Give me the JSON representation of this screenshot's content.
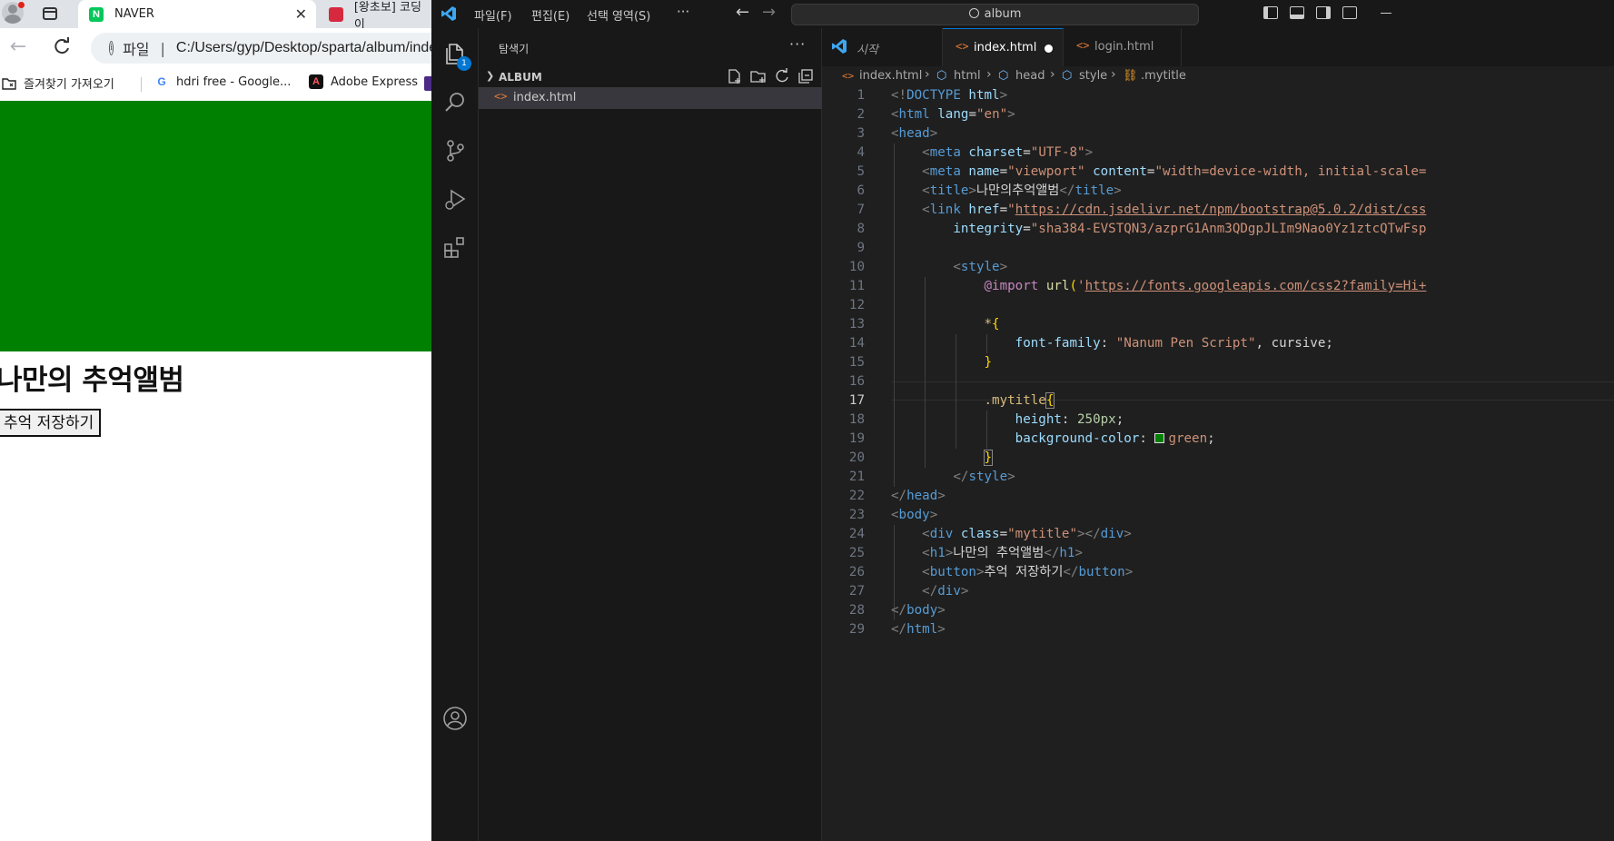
{
  "browser": {
    "tabs": [
      {
        "label": "NAVER",
        "icon": "naver-icon"
      },
      {
        "label": "[왕초보] 코딩이",
        "icon": "book-icon"
      }
    ],
    "address": {
      "scheme_label": "파일",
      "url": "C:/Users/gyp/Desktop/sparta/album/index.html"
    },
    "bookmarks": [
      {
        "label": "즐겨찾기 가져오기",
        "icon": "folder-import-icon"
      },
      {
        "label": "hdri free - Google...",
        "icon": "google-icon"
      },
      {
        "label": "Adobe Express",
        "icon": "adobe-express-icon"
      }
    ],
    "page": {
      "heading": "나만의 추억앨범",
      "button_label": "추억 저장하기",
      "banner_color": "#008000"
    }
  },
  "vscode": {
    "menu": [
      "파일(F)",
      "편집(E)",
      "선택 영역(S)",
      "···"
    ],
    "search_label": "album",
    "sidebar": {
      "title": "탐색기",
      "more": "···",
      "folder": "ALBUM",
      "files": [
        {
          "name": "index.html",
          "icon": "html-file-icon"
        }
      ]
    },
    "badge_count": "1",
    "tabs": [
      {
        "label": "시작",
        "icon": "vscode-icon"
      },
      {
        "label": "index.html",
        "icon": "html-file-icon",
        "modified": true
      },
      {
        "label": "login.html",
        "icon": "html-file-icon"
      }
    ],
    "breadcrumbs": [
      "index.html",
      "html",
      "head",
      "style",
      ".mytitle"
    ],
    "current_line": 17,
    "line_numbers": [
      "1",
      "2",
      "3",
      "4",
      "5",
      "6",
      "7",
      "8",
      "9",
      "10",
      "11",
      "12",
      "13",
      "14",
      "15",
      "16",
      "17",
      "18",
      "19",
      "20",
      "21",
      "22",
      "23",
      "24",
      "25",
      "26",
      "27",
      "28",
      "29"
    ],
    "code": {
      "l1": {
        "a": "<!",
        "b": "DOCTYPE",
        "c": " html",
        "d": ">"
      },
      "l2": {
        "a": "<",
        "b": "html",
        "c": " lang",
        "d": "=",
        "e": "\"en\"",
        "f": ">"
      },
      "l3": {
        "a": "<",
        "b": "head",
        "c": ">"
      },
      "l4": {
        "a": "<",
        "b": "meta",
        "c": " charset",
        "d": "=",
        "e": "\"UTF-8\"",
        "f": ">"
      },
      "l5": {
        "a": "<",
        "b": "meta",
        "c": " name",
        "d": "=",
        "e": "\"viewport\"",
        "f": " content",
        "g": "=",
        "h": "\"width=device-width, initial-scale="
      },
      "l6": {
        "a": "<",
        "b": "title",
        "c": ">",
        "d": "나만의추억앨범",
        "e": "</",
        "f": "title",
        "g": ">"
      },
      "l7": {
        "a": "<",
        "b": "link",
        "c": " href",
        "d": "=",
        "e": "\"",
        "f": "https://cdn.jsdelivr.net/npm/bootstrap@5.0.2/dist/css"
      },
      "l8": {
        "a": "integrity",
        "b": "=",
        "c": "\"sha384-EVSTQN3/azprG1Anm3QDgpJLIm9Nao0Yz1ztcQTwFsp"
      },
      "l10": {
        "a": "<",
        "b": "style",
        "c": ">"
      },
      "l11": {
        "a": "@import",
        "b": " url",
        "c": "(",
        "d": "'",
        "e": "https://fonts.googleapis.com/css2?family=Hi+"
      },
      "l13": {
        "a": "*",
        "b": "{"
      },
      "l14": {
        "a": "font-family",
        "b": ": ",
        "c": "\"Nanum Pen Script\"",
        "d": ", cursive;"
      },
      "l15": {
        "a": "}"
      },
      "l17": {
        "a": ".mytitle",
        "b": "{"
      },
      "l18": {
        "a": "height",
        "b": ": ",
        "c": "250px",
        "d": ";"
      },
      "l19": {
        "a": "background-color",
        "b": ": ",
        "c": "green",
        "d": ";"
      },
      "l20": {
        "a": "}"
      },
      "l21": {
        "a": "</",
        "b": "style",
        "c": ">"
      },
      "l22": {
        "a": "</",
        "b": "head",
        "c": ">"
      },
      "l23": {
        "a": "<",
        "b": "body",
        "c": ">"
      },
      "l24": {
        "a": "<",
        "b": "div",
        "c": " class",
        "d": "=",
        "e": "\"mytitle\"",
        "f": "></",
        "g": "div",
        "h": ">"
      },
      "l25": {
        "a": "<",
        "b": "h1",
        "c": ">",
        "d": "나만의 추억앨범",
        "e": "</",
        "f": "h1",
        "g": ">"
      },
      "l26": {
        "a": "<",
        "b": "button",
        "c": ">",
        "d": "추억 저장하기",
        "e": "</",
        "f": "button",
        "g": ">"
      },
      "l27": {
        "a": "</",
        "b": "div",
        "c": ">"
      },
      "l28": {
        "a": "</",
        "b": "body",
        "c": ">"
      },
      "l29": {
        "a": "</",
        "b": "html",
        "c": ">"
      }
    }
  }
}
